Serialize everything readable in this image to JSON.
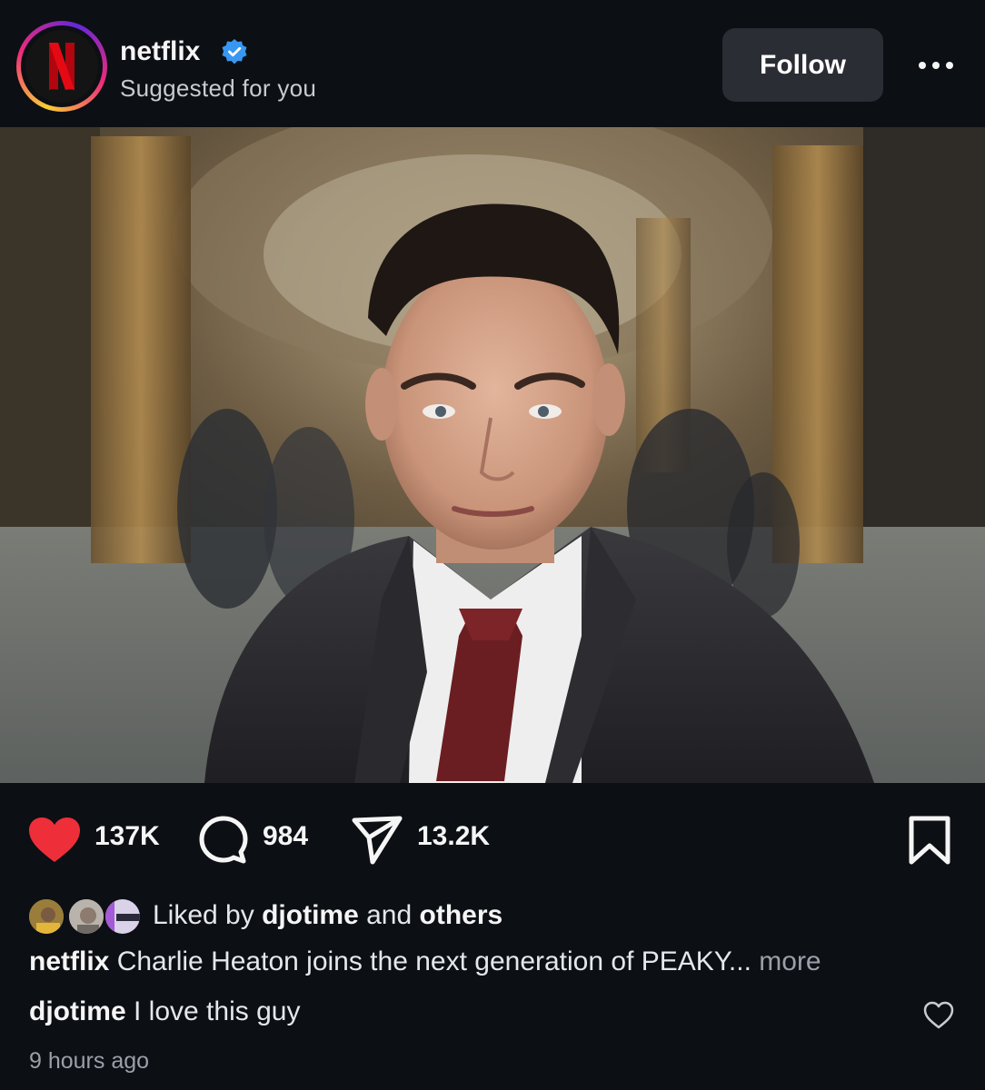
{
  "header": {
    "username": "netflix",
    "subtitle": "Suggested for you",
    "verified": true,
    "follow_label": "Follow",
    "avatar_letter": "N"
  },
  "post": {
    "image_description_icon": "photo"
  },
  "actions": {
    "likes_count": "137K",
    "comments_count": "984",
    "shares_count": "13.2K",
    "liked": true
  },
  "likes_summary": {
    "prefix": "Liked by",
    "user": "djotime",
    "middle": "and",
    "suffix": "others"
  },
  "caption": {
    "user": "netflix",
    "text": "Charlie Heaton joins the next generation of PEAKY...",
    "more_label": "more"
  },
  "comment": {
    "user": "djotime",
    "text": "I love this guy"
  },
  "timestamp": "9 hours ago",
  "colors": {
    "background": "#0c0f14",
    "like_red": "#ee2f3a",
    "follow_bg": "#2a2d33",
    "netflix_red": "#e50914",
    "verified_blue": "#3897f0"
  }
}
